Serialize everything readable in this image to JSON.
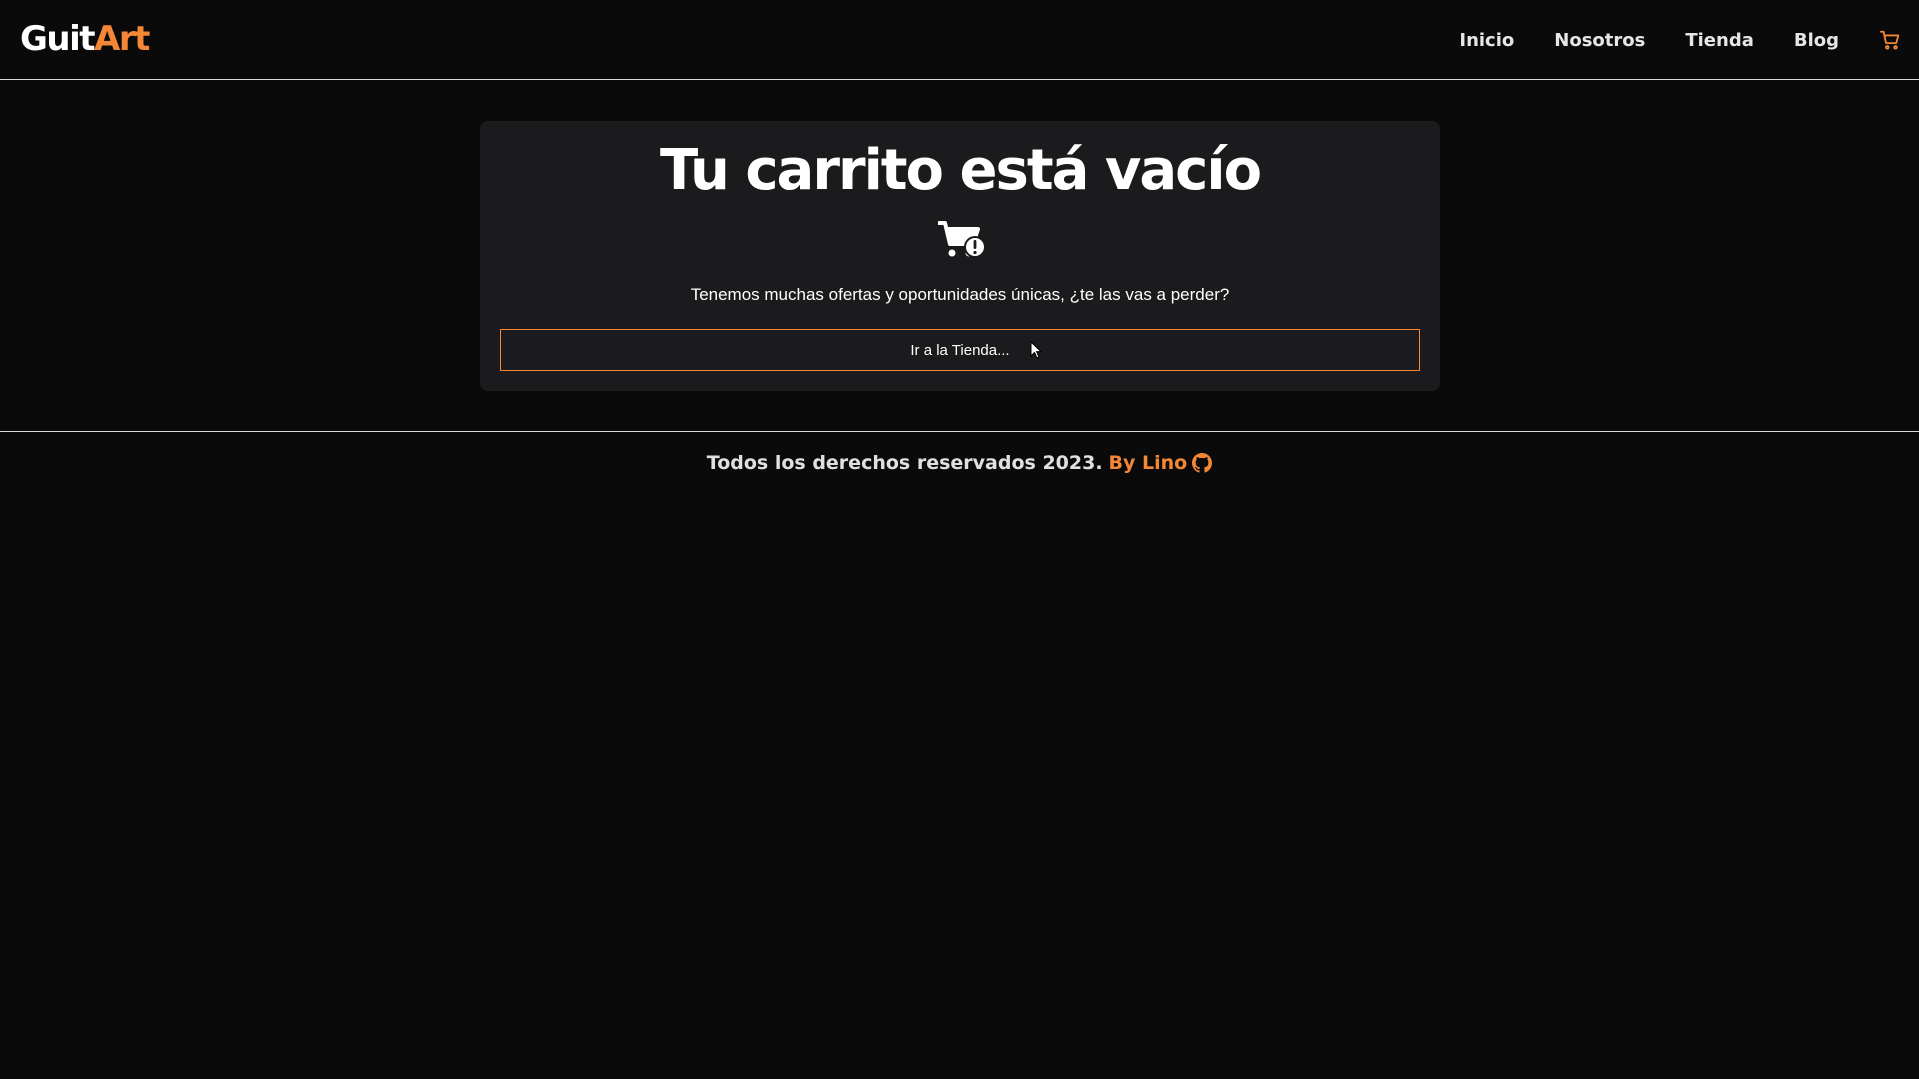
{
  "header": {
    "logo_part_a": "Guit",
    "logo_part_b": "Art",
    "nav": [
      {
        "label": "Inicio"
      },
      {
        "label": "Nosotros"
      },
      {
        "label": "Tienda"
      },
      {
        "label": "Blog"
      }
    ],
    "cart_icon": "cart-icon"
  },
  "cart": {
    "title": "Tu carrito está vacío",
    "icon": "cart-warning-icon",
    "message": "Tenemos muchas ofertas y oportunidades únicas, ¿te las vas a perder?",
    "button_label": "Ir a la Tienda..."
  },
  "footer": {
    "copyright": "Todos los derechos reservados 2023.",
    "author": "By Lino",
    "author_icon": "github-icon"
  },
  "colors": {
    "background": "#0a0a0b",
    "card_background": "#1b1b1d",
    "accent": "#f48735",
    "text": "#ffffff"
  }
}
